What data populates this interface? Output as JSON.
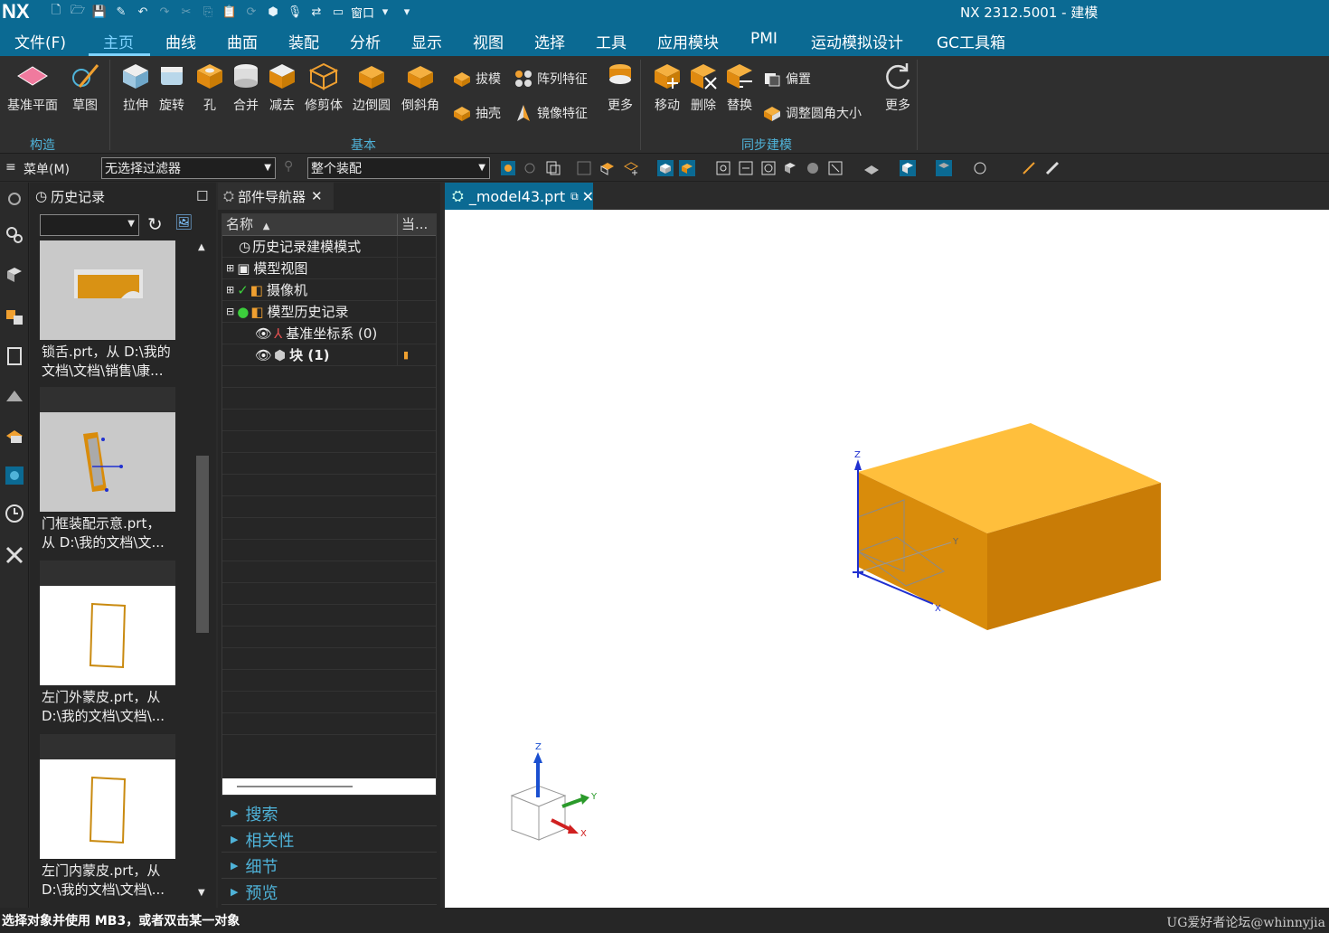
{
  "titlebar": {
    "logo": "NX",
    "window_menu": "窗口",
    "title": "NX 2312.5001 - 建模"
  },
  "menubar": {
    "items": [
      "文件(F)",
      "主页",
      "曲线",
      "曲面",
      "装配",
      "分析",
      "显示",
      "视图",
      "选择",
      "工具",
      "应用模块",
      "PMI",
      "运动模拟设计",
      "GC工具箱"
    ],
    "active": "主页"
  },
  "ribbon": {
    "construct": {
      "datum_plane": "基准平面",
      "sketch": "草图",
      "group": "构造"
    },
    "basic": {
      "extrude": "拉伸",
      "revolve": "旋转",
      "hole": "孔",
      "unite": "合并",
      "subtract": "减去",
      "trim_body": "修剪体",
      "edge_blend": "边倒圆",
      "chamfer": "倒斜角",
      "draft": "拔模",
      "pattern_feature": "阵列特征",
      "shell": "抽壳",
      "mirror_feature": "镜像特征",
      "more": "更多",
      "group": "基本"
    },
    "sync": {
      "move": "移动",
      "delete": "删除",
      "replace": "替换",
      "offset": "偏置",
      "resize_blend": "调整圆角大小",
      "more": "更多",
      "group": "同步建模"
    }
  },
  "toolbar2": {
    "menu_label": "菜单(M)",
    "filter_value": "无选择过滤器",
    "scope_value": "整个装配"
  },
  "history": {
    "title": "历史记录",
    "items": [
      {
        "caption_line1": "锁舌.prt，从 D:\\我的",
        "caption_line2": "文档\\文档\\销售\\康..."
      },
      {
        "caption_line1": "门框装配示意.prt，",
        "caption_line2": "从 D:\\我的文档\\文..."
      },
      {
        "caption_line1": "左门外蒙皮.prt，从",
        "caption_line2": "D:\\我的文档\\文档\\..."
      },
      {
        "caption_line1": "左门内蒙皮.prt，从",
        "caption_line2": "D:\\我的文档\\文档\\..."
      }
    ]
  },
  "part_navigator": {
    "tab": "部件导航器",
    "col_name": "名称",
    "col_current": "当...",
    "rows": [
      {
        "label": "历史记录建模模式"
      },
      {
        "label": "模型视图"
      },
      {
        "label": "摄像机"
      },
      {
        "label": "模型历史记录"
      },
      {
        "label": "基准坐标系 (0)"
      },
      {
        "label": "块 (1)"
      }
    ],
    "sections": [
      "搜索",
      "相关性",
      "细节",
      "预览"
    ]
  },
  "viewport": {
    "tab": "_model43.prt",
    "triad": {
      "x": "X",
      "y": "Y",
      "z": "Z"
    }
  },
  "status": {
    "message": "选择对象并使用 MB3，或者双击某一对象",
    "watermark": "UG爱好者论坛@whinnyjia"
  },
  "colors": {
    "accent": "#0b6a93",
    "block_top": "#ffbf3c",
    "block_front": "#d98c0b",
    "block_side": "#c97c06"
  }
}
